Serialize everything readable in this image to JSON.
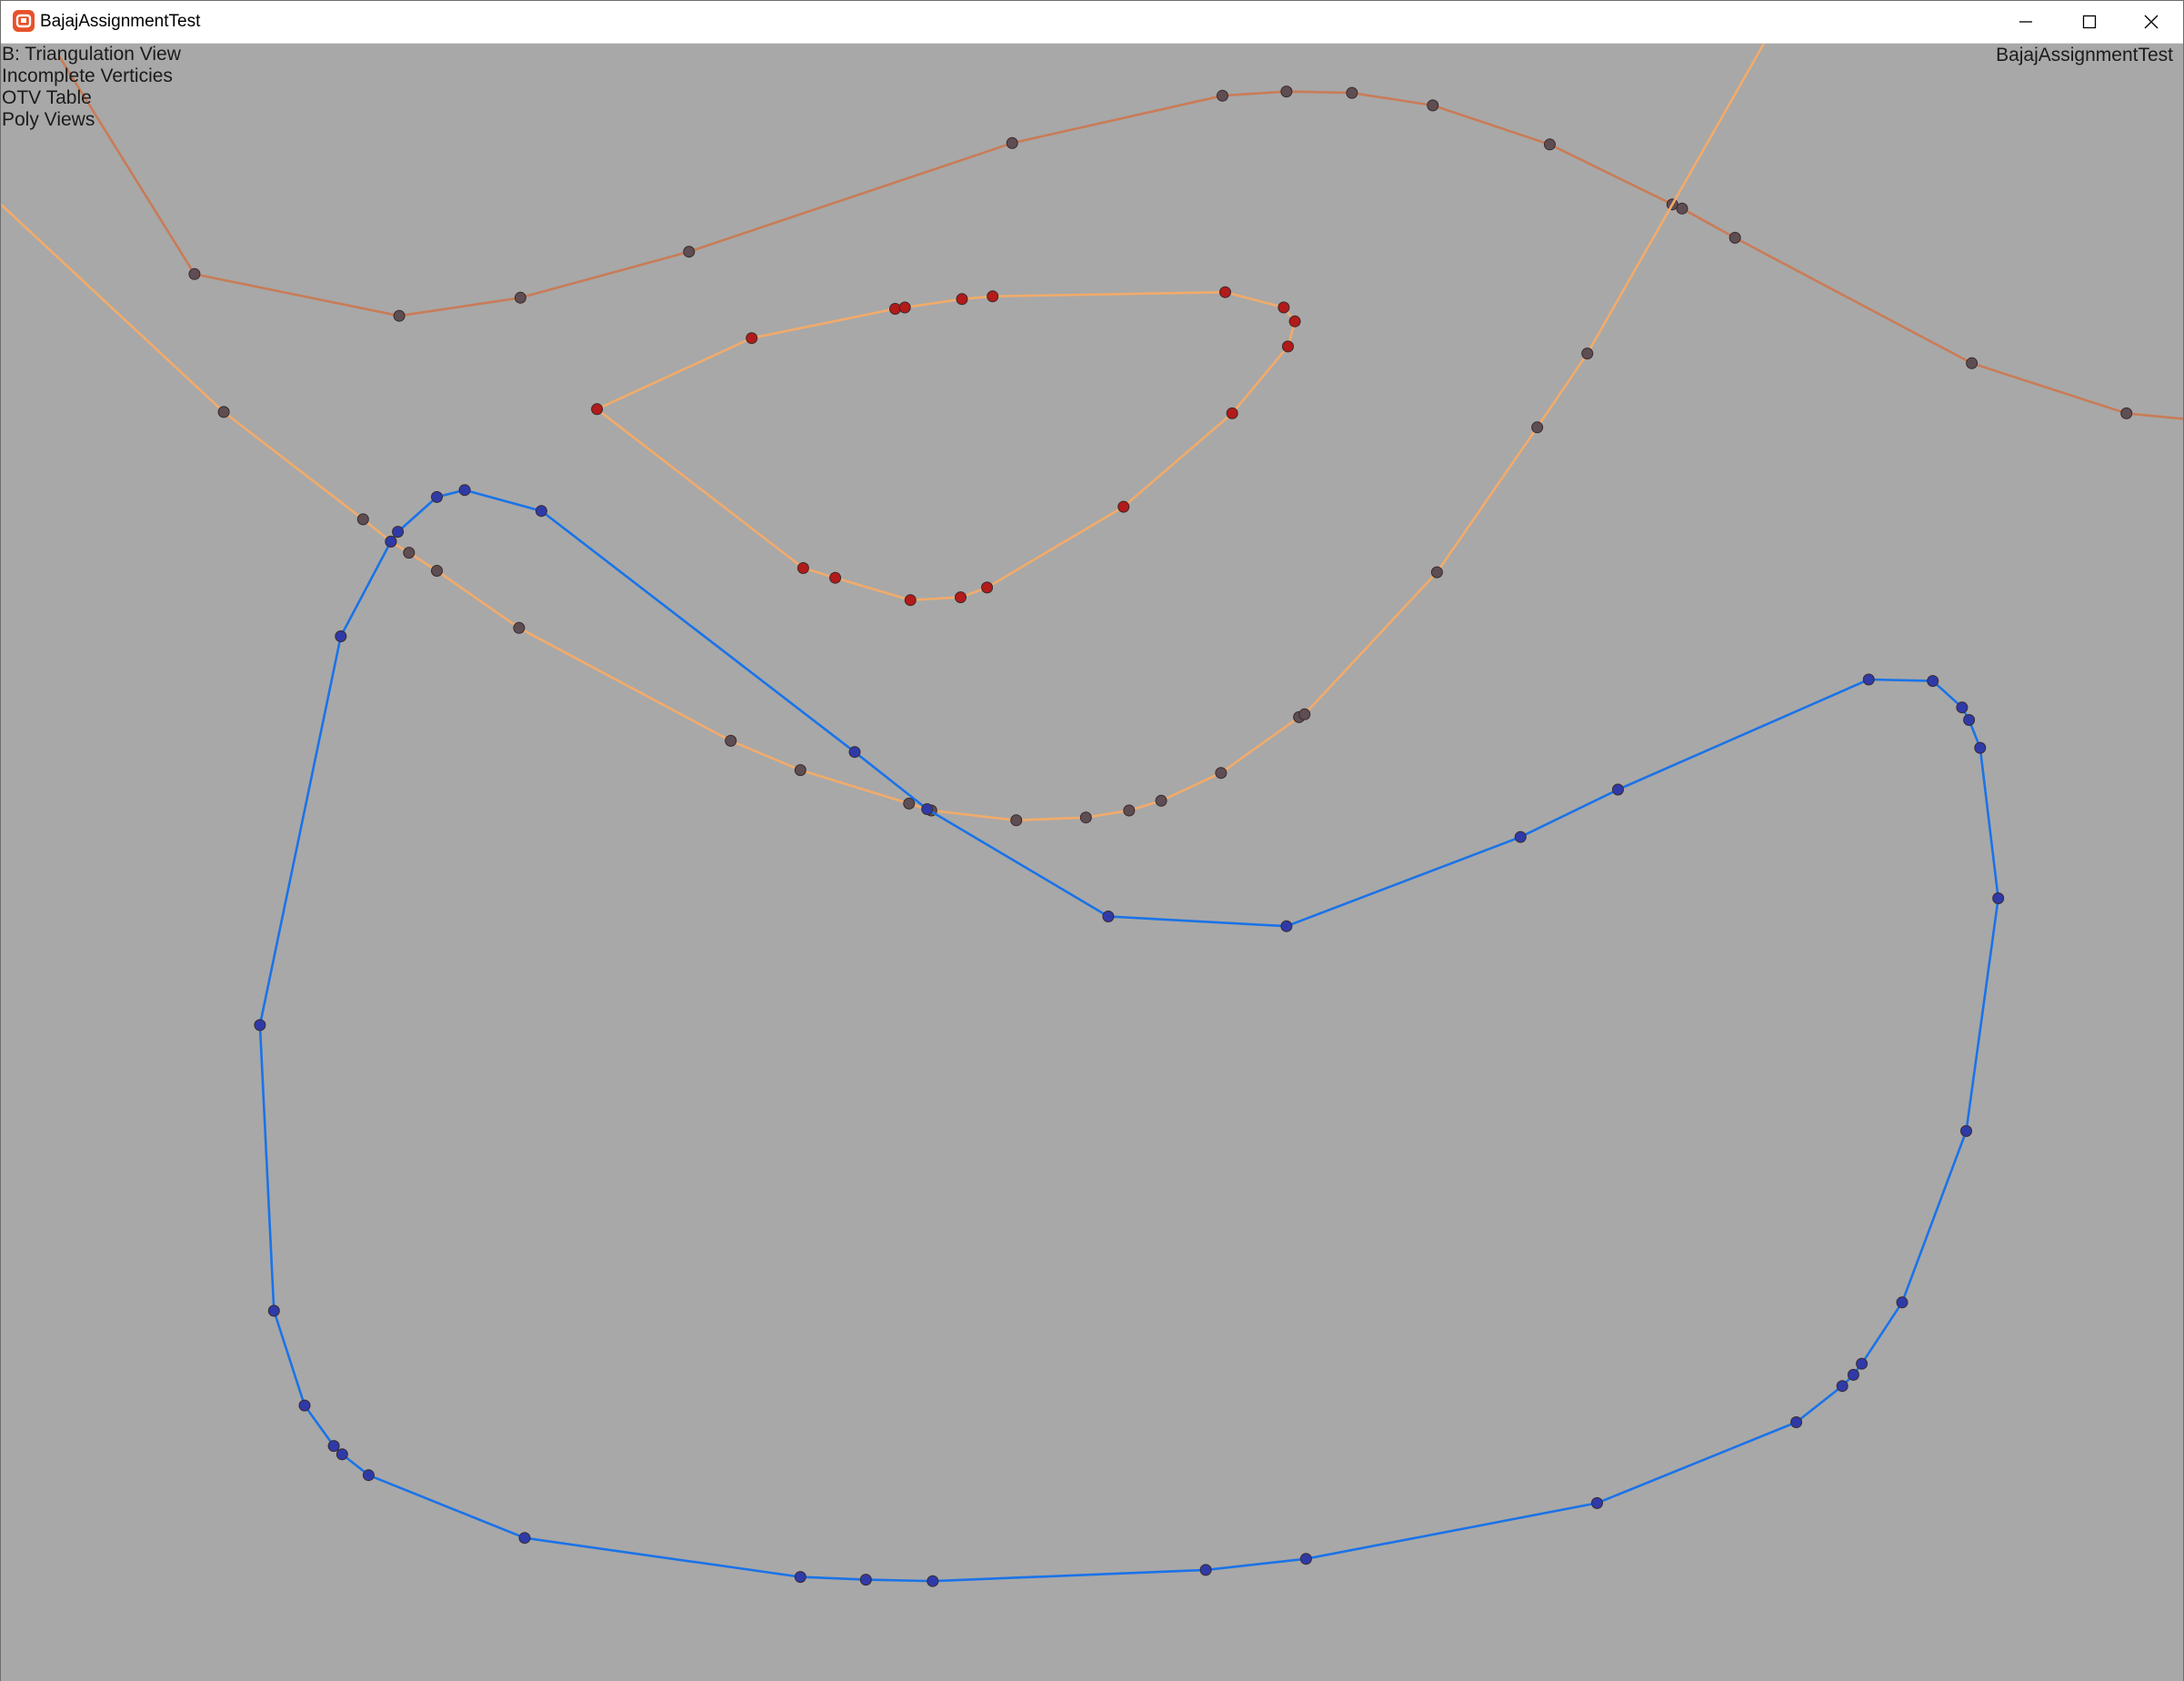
{
  "window": {
    "title": "BajajAssignmentTest",
    "buttons": {
      "minimize": "minimize-icon",
      "maximize": "maximize-icon",
      "close": "close-icon"
    }
  },
  "overlay": {
    "menu_lines": [
      "B: Triangulation View",
      "Incomplete Verticies",
      "OTV Table",
      "Poly Views"
    ],
    "app_name": "BajajAssignmentTest"
  },
  "colors": {
    "background": "#a8a8a8",
    "outer_curve": "#c97c57",
    "inner_curves": "#f2ab6a",
    "blue_polygon": "#1a73e8",
    "vertex_dark": "#5e4d52",
    "vertex_red": "#b31a1a",
    "vertex_blue": "#2f3aa8"
  }
}
